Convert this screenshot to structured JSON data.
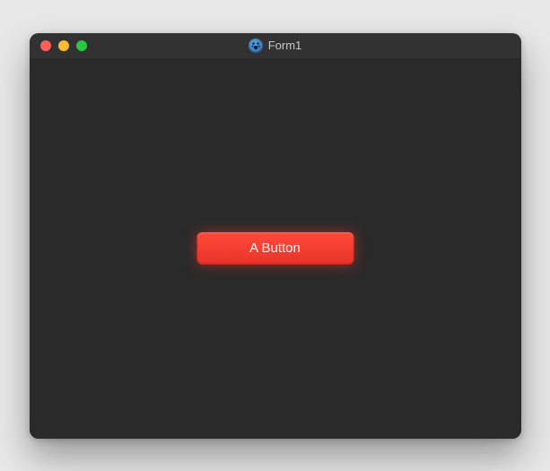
{
  "window": {
    "title": "Form1"
  },
  "content": {
    "button_label": "A Button"
  }
}
